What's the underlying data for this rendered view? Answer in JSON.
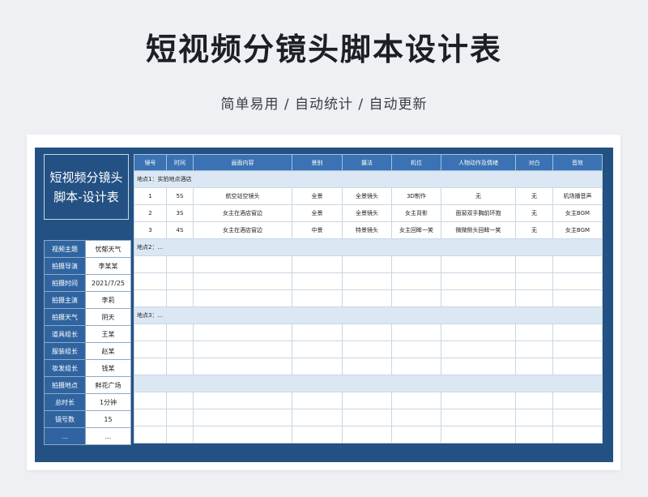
{
  "header": {
    "title": "短视频分镜头脚本设计表",
    "subtitle": "简单易用 / 自动统计 / 自动更新"
  },
  "sheet_title": "短视频分镜头脚本-设计表",
  "info": [
    {
      "k": "视频主题",
      "v": "忧郁天气"
    },
    {
      "k": "拍摄导演",
      "v": "李某某"
    },
    {
      "k": "拍摄时间",
      "v": "2021/7/25"
    },
    {
      "k": "拍摄主演",
      "v": "李莉"
    },
    {
      "k": "拍摄天气",
      "v": "阴天"
    },
    {
      "k": "道具组长",
      "v": "王某"
    },
    {
      "k": "服装组长",
      "v": "赵某"
    },
    {
      "k": "妆发组长",
      "v": "钱某"
    },
    {
      "k": "拍摄地点",
      "v": "鲜花广场"
    },
    {
      "k": "总时长",
      "v": "1分钟"
    },
    {
      "k": "镜号数",
      "v": "15"
    },
    {
      "k": "...",
      "v": "..."
    }
  ],
  "columns": [
    "镜号",
    "时间",
    "画面内容",
    "景别",
    "摄法",
    "机位",
    "人物动作及情绪",
    "对白",
    "音效"
  ],
  "sections": [
    {
      "label": "地点1：实拍地点酒店",
      "rows": [
        [
          "1",
          "5S",
          "航空站空镜头",
          "全景",
          "全景镜头",
          "3D制作",
          "无",
          "无",
          "机场播音声"
        ],
        [
          "2",
          "3S",
          "女主在酒店窗边",
          "全景",
          "全景镜头",
          "女主背影",
          "面窗双手胸前环抱",
          "无",
          "女主BGM"
        ],
        [
          "3",
          "4S",
          "女主在酒店窗边",
          "中景",
          "特景镜头",
          "女主回眸一笑",
          "微微侧头回眸一笑",
          "无",
          "女主BGM"
        ]
      ]
    },
    {
      "label": "地点2：...",
      "rows": []
    },
    {
      "label": "地点3：...",
      "rows": []
    },
    {
      "label": "",
      "rows": []
    }
  ]
}
